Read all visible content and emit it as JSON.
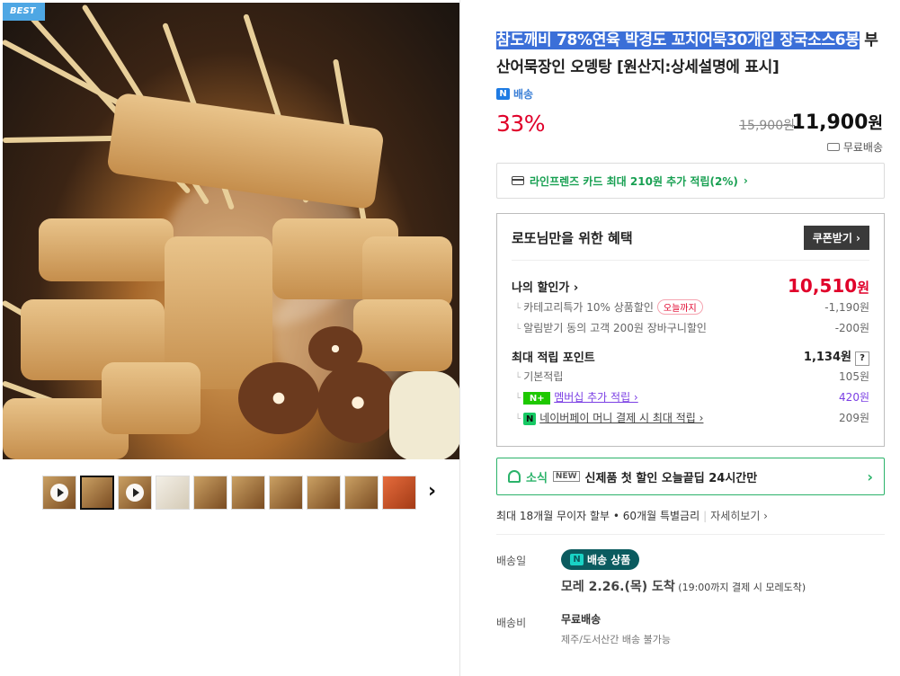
{
  "gallery": {
    "badge": "BEST",
    "thumbs": [
      {
        "type": "video"
      },
      {
        "type": "image",
        "active": true
      },
      {
        "type": "video"
      },
      {
        "type": "image",
        "tone": "light"
      },
      {
        "type": "image"
      },
      {
        "type": "image"
      },
      {
        "type": "image"
      },
      {
        "type": "image"
      },
      {
        "type": "image"
      },
      {
        "type": "image",
        "tone": "red"
      }
    ],
    "next_icon": "chevron-right-icon",
    "next_symbol": "›"
  },
  "product": {
    "title_highlighted": "참도깨비 78%연육 박경도 꼬치어묵30개입 장국소스6봉",
    "title_rest": " 부산어묵장인 오뎅탕 [원산지:상세설명에 표시]",
    "delivery_badge": "N",
    "delivery_label": "배송",
    "discount_rate": "33%",
    "original_price": "15,900원",
    "final_price_number": "11,900",
    "final_price_unit": "원",
    "shipping_fee_label": "무료배송"
  },
  "card_benefit": {
    "text": "라인프렌즈 카드 최대 210원 추가 적립(2%)",
    "arrow": "›"
  },
  "benefit_box": {
    "title": "로또님만을 위한 혜택",
    "coupon_button": "쿠폰받기 ›",
    "my_price_label": "나의 할인가 ›",
    "my_price_number": "10,510",
    "my_price_unit": "원",
    "category_discount_label": "카테고리특가 10% 상품할인",
    "today_tag": "오늘까지",
    "category_discount_value": "-1,190원",
    "alarm_discount_label": "알림받기 동의 고객 200원 장바구니할인",
    "alarm_discount_value": "-200원",
    "max_points_label": "최대 적립 포인트",
    "max_points_value": "1,134원",
    "help_symbol": "?",
    "base_points_label": "기본적립",
    "base_points_value": "105원",
    "membership_badge": "N+",
    "membership_label": "멤버십 추가 적립 ›",
    "membership_value": "420원",
    "npay_badge": "N",
    "npay_label": "네이버페이 머니 결제 시 최대 적립 ›",
    "npay_value": "209원"
  },
  "news": {
    "label": "소식",
    "new_tag": "NEW",
    "text": "신제품 첫 할인 오늘끝딥 24시간만",
    "arrow": "›"
  },
  "installment": {
    "text": "최대 18개월 무이자 할부 • 60개월 특별금리",
    "link": "자세히보기 ›"
  },
  "shipping": {
    "date_label": "배송일",
    "pill_badge": "N",
    "pill_text": "배송 상품",
    "arrive_main": "모레 2.26.(목) 도착",
    "arrive_note": " (19:00까지 결제 시 모레도착)",
    "fee_label": "배송비",
    "fee_value": "무료배송",
    "fee_note": "제주/도서산간 배송 불가능"
  }
}
